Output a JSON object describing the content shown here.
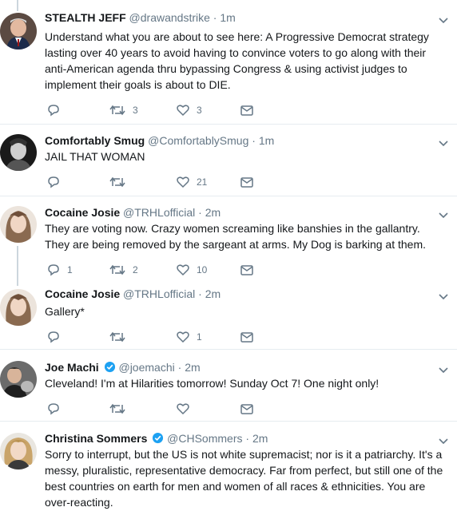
{
  "tweets": [
    {
      "name": "STEALTH JEFF",
      "handle": "@drawandstrike",
      "dot": "·",
      "time": "1m",
      "text": "Understand what you are about to see here: A Progressive Democrat strategy lasting over 40 years to avoid having to convince voters to go along with their anti-American agenda thru bypassing Congress & using activist judges to implement their goals is about to DIE.",
      "replies": "",
      "retweets": "3",
      "likes": "3",
      "verified": false,
      "avatar_color": "#3a2a24"
    },
    {
      "name": "Comfortably Smug",
      "handle": "@ComfortablySmug",
      "dot": "·",
      "time": "1m",
      "text": "JAIL THAT WOMAN",
      "replies": "",
      "retweets": "",
      "likes": "21",
      "verified": false,
      "avatar_color": "#222222"
    },
    {
      "name": "Cocaine Josie",
      "handle": "@TRHLofficial",
      "dot": "·",
      "time": "2m",
      "text": "They are voting now. Crazy women screaming like banshies in the gallantry. They are being removed by the sargeant at arms. My Dog is barking at them.",
      "replies": "1",
      "retweets": "2",
      "likes": "10",
      "verified": false,
      "avatar_color": "#d8c8b8"
    },
    {
      "name": "Cocaine Josie",
      "handle": "@TRHLofficial",
      "dot": "·",
      "time": "2m",
      "text": "Gallery*",
      "replies": "",
      "retweets": "",
      "likes": "1",
      "verified": false,
      "avatar_color": "#d8c8b8"
    },
    {
      "name": "Joe Machi",
      "handle": "@joemachi",
      "dot": "·",
      "time": "2m",
      "text": "Cleveland! I'm at Hilarities tomorrow! Sunday Oct 7! One night only!",
      "replies": "",
      "retweets": "",
      "likes": "",
      "verified": true,
      "avatar_color": "#4a4a4a"
    },
    {
      "name": "Christina Sommers",
      "handle": "@CHSommers",
      "dot": "·",
      "time": "2m",
      "text": "Sorry to interrupt, but the US is not white supremacist; nor is it a patriarchy. It's a messy, pluralistic, representative democracy.  Far from perfect, but still one of the best countries on earth for men and women of all races & ethnicities. You are over-reacting.",
      "replies": "",
      "retweets": "",
      "likes": "",
      "verified": true,
      "avatar_color": "#c9a46a"
    }
  ],
  "colors": {
    "text": "#14171a",
    "secondary": "#657786",
    "verified": "#1da1f2",
    "border": "#e6ecf0",
    "thread": "#ccd6dd"
  },
  "icons": {
    "reply": "reply-icon",
    "retweet": "retweet-icon",
    "like": "heart-icon",
    "dm": "direct-message-icon",
    "caret": "chevron-down-icon",
    "verified": "verified-badge-icon"
  }
}
